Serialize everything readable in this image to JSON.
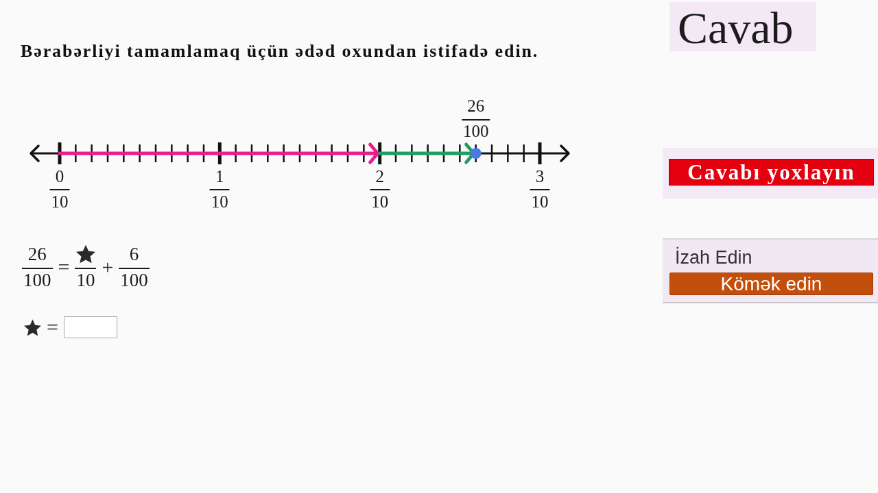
{
  "instruction": "Bərabərliyi tamamlamaq üçün ədəd oxundan istifadə edin.",
  "number_line": {
    "tick_labels": [
      {
        "numerator": "0",
        "denominator": "10"
      },
      {
        "numerator": "1",
        "denominator": "10"
      },
      {
        "numerator": "2",
        "denominator": "10"
      },
      {
        "numerator": "3",
        "denominator": "10"
      }
    ],
    "point": {
      "numerator": "26",
      "denominator": "100"
    },
    "jumps": [
      {
        "color": "#ee1a8f"
      },
      {
        "color": "#1f9d62"
      }
    ]
  },
  "equation": [
    {
      "kind": "fraction",
      "numerator": "26",
      "denominator": "100"
    },
    {
      "kind": "operator",
      "text": "="
    },
    {
      "kind": "star_fraction",
      "denominator": "10"
    },
    {
      "kind": "operator",
      "text": "+"
    },
    {
      "kind": "fraction",
      "numerator": "6",
      "denominator": "100"
    }
  ],
  "answer_row": [
    {
      "kind": "star"
    },
    {
      "kind": "operator",
      "text": "="
    },
    {
      "kind": "field"
    }
  ],
  "answer_panel": {
    "title": "Cavab"
  },
  "check_button": "Cavabı yoxlayın",
  "help_panel": {
    "label": "İzah Edin",
    "button": "Kömək edin"
  }
}
